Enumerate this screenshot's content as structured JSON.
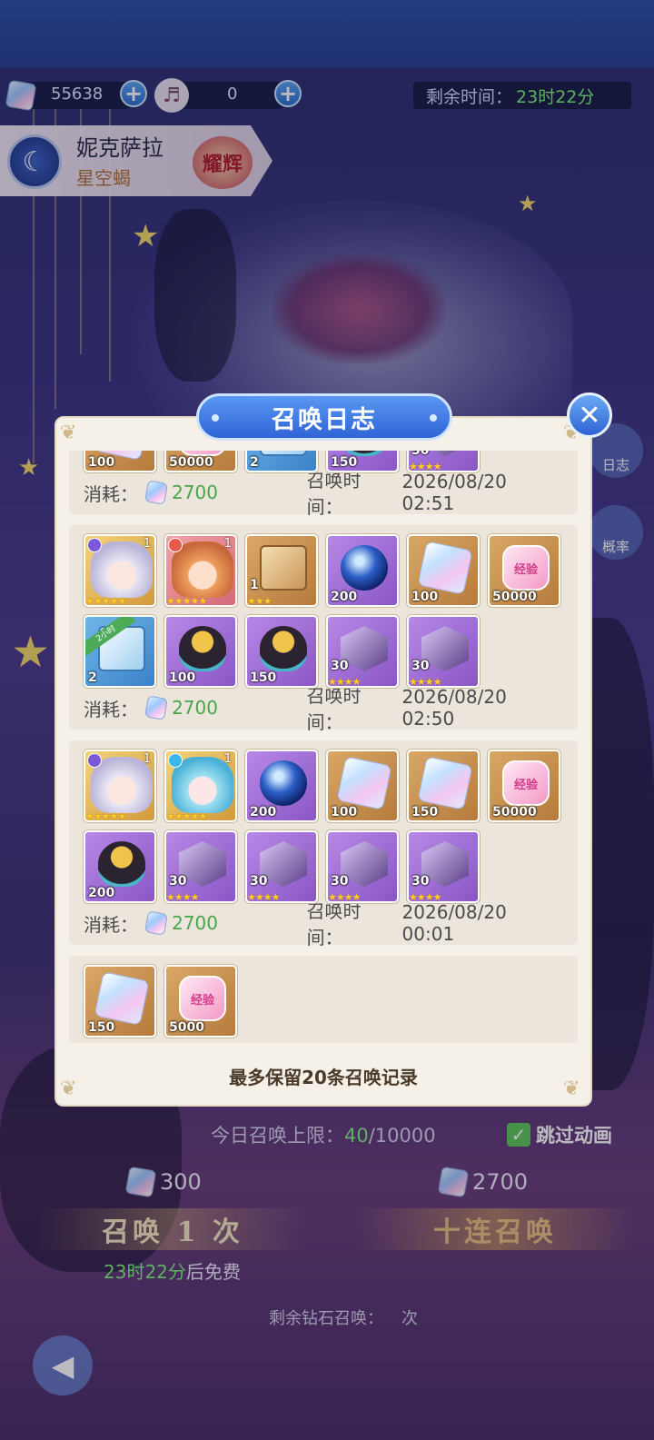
{
  "currency": {
    "diamonds": "55638",
    "tickets": "0"
  },
  "timer": {
    "label": "剩余时间：",
    "value": "23时22分"
  },
  "hero": {
    "name": "妮克萨拉",
    "title": "星空蝎",
    "badge": "耀辉"
  },
  "side_buttons": {
    "log": "日志",
    "rate": "概率"
  },
  "modal": {
    "title": "召唤日志",
    "footer_note": "最多保留20条召唤记录",
    "cost_label": "消耗：",
    "time_label": "召唤时间：",
    "records": [
      {
        "cost": "2700",
        "time": "2026/08/20 02:51",
        "items": [
          {
            "kind": "crystal",
            "color": "orange",
            "qty": "100"
          },
          {
            "kind": "exp",
            "color": "orange",
            "qty": "50000",
            "text": "经验"
          },
          {
            "kind": "chest",
            "color": "blue",
            "qty": "2"
          },
          {
            "kind": "egg",
            "color": "purple",
            "qty": "150"
          },
          {
            "kind": "shard",
            "color": "purple",
            "qty": "30",
            "stars": "★★★★"
          }
        ]
      },
      {
        "cost": "2700",
        "time": "2026/08/20 02:50",
        "items": [
          {
            "kind": "face silver",
            "color": "gold",
            "qty": "",
            "lvl": "1",
            "stars": "★★★★★",
            "elem": "moon"
          },
          {
            "kind": "face ginger",
            "color": "pink",
            "qty": "",
            "lvl": "1",
            "stars": "★★★★★",
            "elem": "fire"
          },
          {
            "kind": "box",
            "color": "orange",
            "qty": "1",
            "stars": "★★★"
          },
          {
            "kind": "orb",
            "color": "purple",
            "qty": "200"
          },
          {
            "kind": "crystal",
            "color": "orange",
            "qty": "100"
          },
          {
            "kind": "exp",
            "color": "orange",
            "qty": "50000",
            "text": "经验"
          },
          {
            "kind": "chest",
            "color": "blue",
            "qty": "2",
            "ribbon": "2小时"
          },
          {
            "kind": "egg",
            "color": "purple",
            "qty": "100"
          },
          {
            "kind": "egg",
            "color": "purple",
            "qty": "150"
          },
          {
            "kind": "shard",
            "color": "purple",
            "qty": "30",
            "stars": "★★★★"
          },
          {
            "kind": "shard",
            "color": "purple",
            "qty": "30",
            "stars": "★★★★"
          }
        ]
      },
      {
        "cost": "2700",
        "time": "2026/08/20 00:01",
        "items": [
          {
            "kind": "face silver",
            "color": "gold",
            "qty": "",
            "lvl": "1",
            "stars": "★★★★★",
            "elem": "moon"
          },
          {
            "kind": "face aqua",
            "color": "gold",
            "qty": "",
            "lvl": "1",
            "stars": "★★★★★",
            "elem": "cyan"
          },
          {
            "kind": "orb",
            "color": "purple",
            "qty": "200"
          },
          {
            "kind": "crystal",
            "color": "orange",
            "qty": "100"
          },
          {
            "kind": "crystal",
            "color": "orange",
            "qty": "150"
          },
          {
            "kind": "exp",
            "color": "orange",
            "qty": "50000",
            "text": "经验"
          },
          {
            "kind": "egg",
            "color": "purple",
            "qty": "200"
          },
          {
            "kind": "shard",
            "color": "purple",
            "qty": "30",
            "stars": "★★★★"
          },
          {
            "kind": "shard",
            "color": "purple",
            "qty": "30",
            "stars": "★★★★"
          },
          {
            "kind": "shard",
            "color": "purple",
            "qty": "30",
            "stars": "★★★★"
          },
          {
            "kind": "shard",
            "color": "purple",
            "qty": "30",
            "stars": "★★★★"
          }
        ]
      },
      {
        "cost": "",
        "time": "",
        "items": [
          {
            "kind": "crystal",
            "color": "orange",
            "qty": "150"
          },
          {
            "kind": "exp",
            "color": "orange",
            "qty": "5000",
            "text": "经验"
          }
        ]
      }
    ]
  },
  "summon": {
    "limit_label": "今日召唤上限：",
    "limit_current": "40",
    "limit_max": "/10000",
    "skip_label": "跳过动画",
    "single_cost": "300",
    "multi_cost": "2700",
    "single_label": "召唤 1 次",
    "multi_label": "十连召唤",
    "free_time": "23时22分",
    "free_suffix": "后免费",
    "remaining_label": "剩余钻石召唤：",
    "remaining_suffix": "次"
  },
  "colors": {
    "accent_blue": "#2f64d6",
    "green_value": "#4aa54a",
    "panel": "#f6f1e8"
  }
}
